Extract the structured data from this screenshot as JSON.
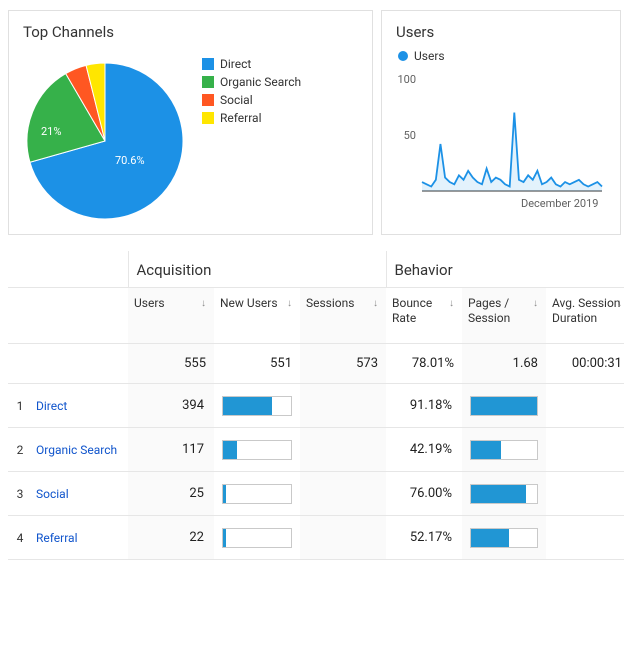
{
  "cards": {
    "topChannels": {
      "title": "Top Channels",
      "legend": [
        "Direct",
        "Organic Search",
        "Social",
        "Referral"
      ],
      "labels": {
        "main": "70.6%",
        "sec": "21%"
      }
    },
    "users": {
      "title": "Users",
      "seriesLabel": "Users",
      "xAxisLabel": "December 2019"
    }
  },
  "chart_data": [
    {
      "type": "pie",
      "title": "Top Channels",
      "categories": [
        "Direct",
        "Organic Search",
        "Social",
        "Referral"
      ],
      "values": [
        70.6,
        21.0,
        4.5,
        3.9
      ],
      "colors": [
        "#1c91e6",
        "#36b14a",
        "#ff5722",
        "#ffe600"
      ]
    },
    {
      "type": "line",
      "title": "Users",
      "series": [
        {
          "name": "Users",
          "values": [
            8,
            6,
            4,
            10,
            42,
            12,
            8,
            6,
            14,
            10,
            18,
            12,
            8,
            6,
            20,
            8,
            12,
            10,
            6,
            4,
            70,
            10,
            8,
            14,
            10,
            18,
            6,
            8,
            12,
            6,
            4,
            8,
            6,
            8,
            10,
            6,
            4,
            6,
            8,
            4
          ]
        }
      ],
      "ylim": [
        0,
        100
      ],
      "yticks": [
        50,
        100
      ],
      "xlabel": "December 2019",
      "ylabel": ""
    }
  ],
  "table": {
    "groups": {
      "acq": "Acquisition",
      "beh": "Behavior"
    },
    "headers": {
      "users": "Users",
      "newUsers": "New Users",
      "sessions": "Sessions",
      "bounce": "Bounce Rate",
      "pps": "Pages / Session",
      "dur": "Avg. Session Duration"
    },
    "totals": {
      "users": "555",
      "newUsers": "551",
      "sessions": "573",
      "bounce": "78.01%",
      "pps": "1.68",
      "dur": "00:00:31"
    },
    "maxNewUsers": 551,
    "rows": [
      {
        "idx": "1",
        "name": "Direct",
        "users": "394",
        "newUsersNum": 394,
        "bounce": "91.18%",
        "bouncePct": 100
      },
      {
        "idx": "2",
        "name": "Organic Search",
        "users": "117",
        "newUsersNum": 117,
        "bounce": "42.19%",
        "bouncePct": 46
      },
      {
        "idx": "3",
        "name": "Social",
        "users": "25",
        "newUsersNum": 25,
        "bounce": "76.00%",
        "bouncePct": 83
      },
      {
        "idx": "4",
        "name": "Referral",
        "users": "22",
        "newUsersNum": 22,
        "bounce": "52.17%",
        "bouncePct": 57
      }
    ]
  }
}
